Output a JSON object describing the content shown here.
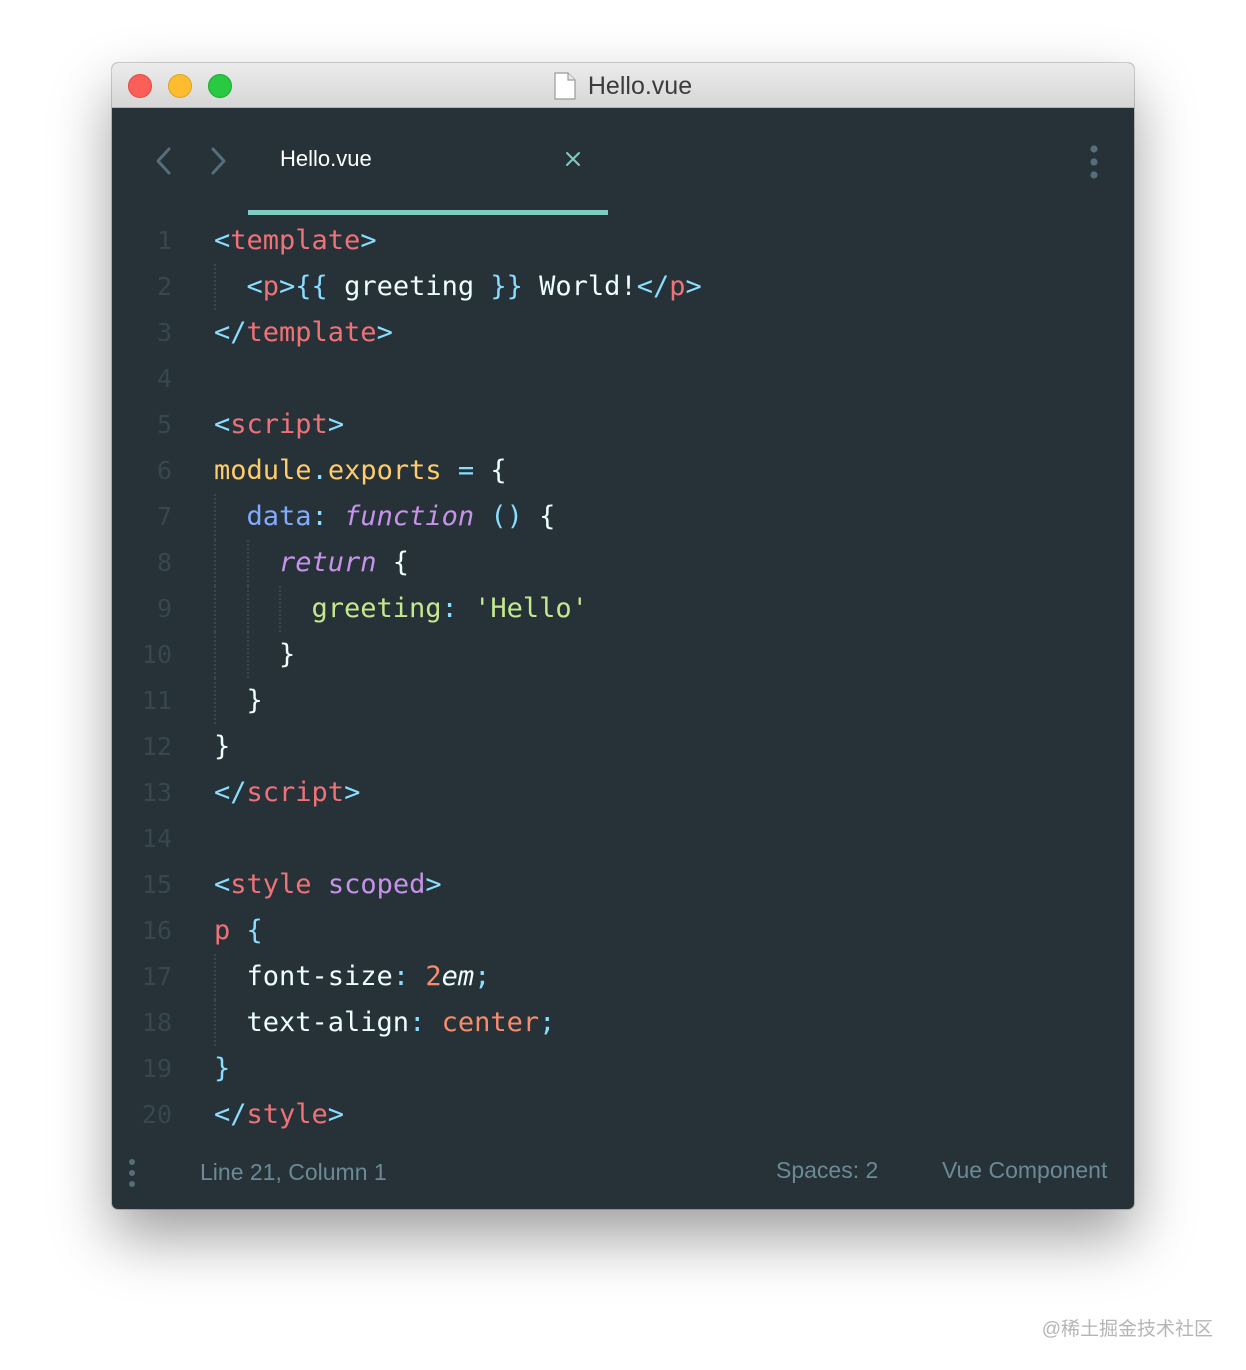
{
  "window": {
    "title": "Hello.vue",
    "icon": "document-icon"
  },
  "tabs": [
    {
      "label": "Hello.vue",
      "active": true,
      "close_icon": "close-icon"
    }
  ],
  "navigation": {
    "back_icon": "chevron-left-icon",
    "forward_icon": "chevron-right-icon",
    "more_icon": "vertical-dots-icon"
  },
  "editor": {
    "lines": [
      {
        "number": "1",
        "indent": 0,
        "tokens": [
          [
            "<",
            "punct"
          ],
          [
            "template",
            "tag"
          ],
          [
            ">",
            "punct"
          ]
        ]
      },
      {
        "number": "2",
        "indent": 1,
        "tokens": [
          [
            "<",
            "punct"
          ],
          [
            "p",
            "tag"
          ],
          [
            ">",
            "punct"
          ],
          [
            "{{",
            "punct"
          ],
          [
            " greeting ",
            "text"
          ],
          [
            "}}",
            "punct"
          ],
          [
            " World!",
            "text"
          ],
          [
            "</",
            "punct"
          ],
          [
            "p",
            "tag"
          ],
          [
            ">",
            "punct"
          ]
        ]
      },
      {
        "number": "3",
        "indent": 0,
        "tokens": [
          [
            "</",
            "punct"
          ],
          [
            "template",
            "tag"
          ],
          [
            ">",
            "punct"
          ]
        ]
      },
      {
        "number": "4",
        "indent": 0,
        "tokens": []
      },
      {
        "number": "5",
        "indent": 0,
        "tokens": [
          [
            "<",
            "punct"
          ],
          [
            "script",
            "tag"
          ],
          [
            ">",
            "punct"
          ]
        ]
      },
      {
        "number": "6",
        "indent": 0,
        "tokens": [
          [
            "module",
            "var"
          ],
          [
            ".",
            "punct"
          ],
          [
            "exports",
            "var"
          ],
          [
            " ",
            "text"
          ],
          [
            "=",
            "punct"
          ],
          [
            " {",
            "text"
          ]
        ]
      },
      {
        "number": "7",
        "indent": 1,
        "tokens": [
          [
            "data",
            "prop"
          ],
          [
            ":",
            "punct"
          ],
          [
            " ",
            "text"
          ],
          [
            "function",
            "keyword"
          ],
          [
            " ",
            "text"
          ],
          [
            "()",
            "punct"
          ],
          [
            " {",
            "text"
          ]
        ]
      },
      {
        "number": "8",
        "indent": 2,
        "tokens": [
          [
            "return",
            "keyword"
          ],
          [
            " {",
            "text"
          ]
        ]
      },
      {
        "number": "9",
        "indent": 3,
        "tokens": [
          [
            "greeting",
            "key"
          ],
          [
            ":",
            "punct"
          ],
          [
            " ",
            "text"
          ],
          [
            "'Hello'",
            "string"
          ]
        ]
      },
      {
        "number": "10",
        "indent": 2,
        "tokens": [
          [
            "}",
            "text"
          ]
        ]
      },
      {
        "number": "11",
        "indent": 1,
        "tokens": [
          [
            "}",
            "text"
          ]
        ]
      },
      {
        "number": "12",
        "indent": 0,
        "tokens": [
          [
            "}",
            "text"
          ]
        ]
      },
      {
        "number": "13",
        "indent": 0,
        "tokens": [
          [
            "</",
            "punct"
          ],
          [
            "script",
            "tag"
          ],
          [
            ">",
            "punct"
          ]
        ]
      },
      {
        "number": "14",
        "indent": 0,
        "tokens": []
      },
      {
        "number": "15",
        "indent": 0,
        "tokens": [
          [
            "<",
            "punct"
          ],
          [
            "style",
            "tag"
          ],
          [
            " ",
            "text"
          ],
          [
            "scoped",
            "attr"
          ],
          [
            ">",
            "punct"
          ]
        ]
      },
      {
        "number": "16",
        "indent": 0,
        "tokens": [
          [
            "p",
            "tag"
          ],
          [
            " ",
            "text"
          ],
          [
            "{",
            "punct"
          ]
        ]
      },
      {
        "number": "17",
        "indent": 1,
        "tokens": [
          [
            "font-size",
            "text"
          ],
          [
            ":",
            "punct"
          ],
          [
            " ",
            "text"
          ],
          [
            "2",
            "number"
          ],
          [
            "em",
            "unit"
          ],
          [
            ";",
            "punct"
          ]
        ]
      },
      {
        "number": "18",
        "indent": 1,
        "tokens": [
          [
            "text-align",
            "text"
          ],
          [
            ":",
            "punct"
          ],
          [
            " ",
            "text"
          ],
          [
            "center",
            "number"
          ],
          [
            ";",
            "punct"
          ]
        ]
      },
      {
        "number": "19",
        "indent": 0,
        "tokens": [
          [
            "}",
            "punct"
          ]
        ]
      },
      {
        "number": "20",
        "indent": 0,
        "tokens": [
          [
            "</",
            "punct"
          ],
          [
            "style",
            "tag"
          ],
          [
            ">",
            "punct"
          ]
        ]
      }
    ]
  },
  "statusbar": {
    "position": "Line 21, Column 1",
    "spaces": "Spaces: 2",
    "syntax": "Vue Component",
    "menu_icon": "vertical-dots-icon"
  },
  "watermark": "@稀土掘金技术社区",
  "colors": {
    "background": "#263238",
    "accent": "#80cbc4",
    "tag": "#f07178",
    "punct": "#89ddff",
    "text": "#eeffff",
    "var": "#ffcb6b",
    "prop": "#82aaff",
    "keyword": "#c792ea",
    "key": "#c3e88d",
    "string": "#c3e88d",
    "number": "#f78c6c",
    "attr": "#c792ea",
    "line_number": "#37474f"
  }
}
